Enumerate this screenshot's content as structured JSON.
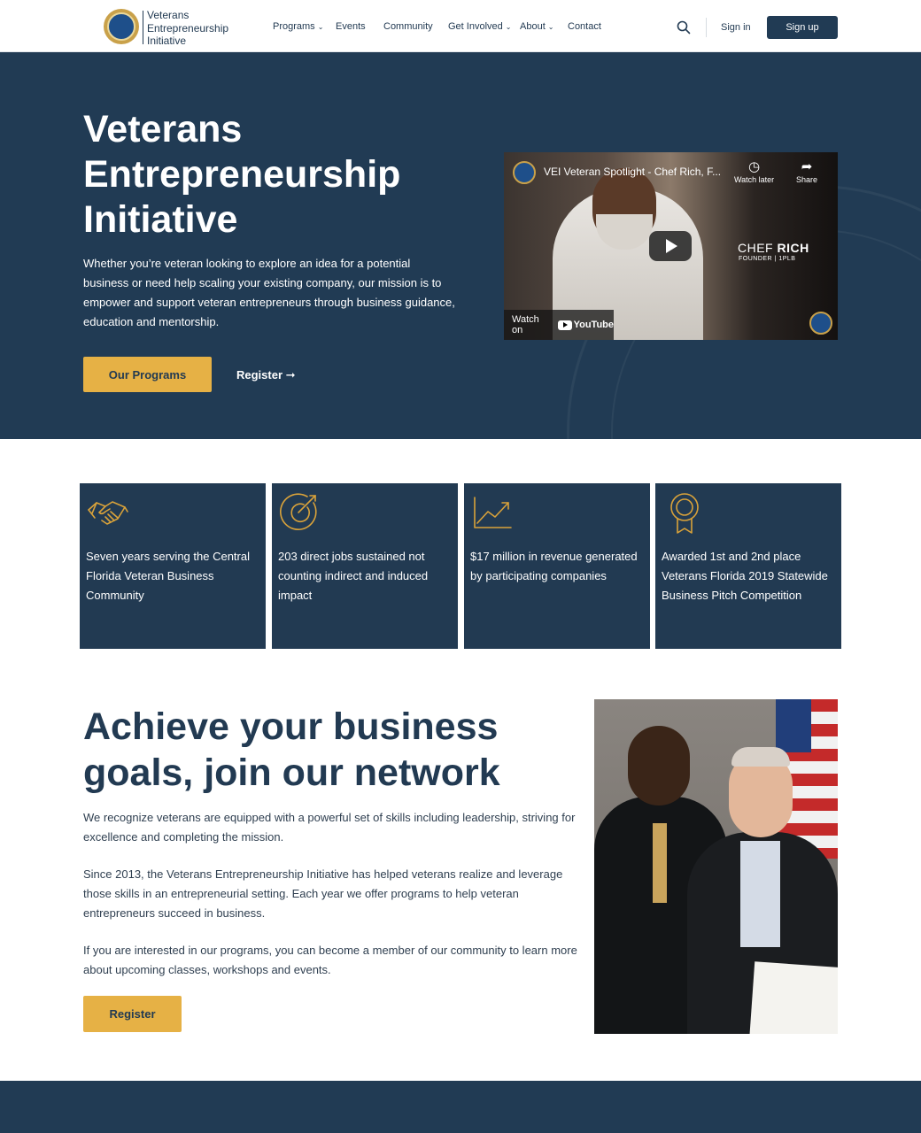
{
  "header": {
    "logo_lines": [
      "Veterans",
      "Entrepreneurship",
      "Initiative"
    ],
    "nav": [
      {
        "label": "Programs",
        "has_dropdown": true
      },
      {
        "label": "Events",
        "has_dropdown": false
      },
      {
        "label": "Community",
        "has_dropdown": false
      },
      {
        "label": "Get Involved",
        "has_dropdown": true
      },
      {
        "label": "About",
        "has_dropdown": true
      },
      {
        "label": "Contact",
        "has_dropdown": false
      }
    ],
    "sign_in": "Sign in",
    "sign_up": "Sign up",
    "search_icon": "search-icon"
  },
  "hero": {
    "title": "Veterans Entrepreneurship Initiative",
    "text": "Whether you’re veteran looking to explore an idea for a potential business or need help scaling your existing company, our mission is to empower and support veteran entrepreneurs through business guidance, education and mentorship.",
    "primary_button": "Our Programs",
    "secondary_link": "Register ➞",
    "video": {
      "title": "VEI Veteran Spotlight - Chef Rich, F...",
      "watch_later": "Watch later",
      "share": "Share",
      "name_label_1": "CHEF",
      "name_label_2": "RICH",
      "role_label": "FOUNDER | 1PLB",
      "watch_on": "Watch on",
      "youtube": "YouTube"
    }
  },
  "stats": [
    {
      "icon": "handshake-icon",
      "text": "Seven years serving the Central Florida Veteran Business Community"
    },
    {
      "icon": "target-icon",
      "text": "203 direct jobs sustained not counting indirect and induced impact"
    },
    {
      "icon": "growth-chart-icon",
      "text": "$17 million in revenue generated by participating companies"
    },
    {
      "icon": "award-ribbon-icon",
      "text": "Awarded 1st and 2nd place Veterans Florida 2019 Statewide Business Pitch Competition"
    }
  ],
  "achieve": {
    "title": "Achieve your business goals, join our network",
    "paragraphs": [
      "We recognize veterans are equipped with a powerful set of skills including leadership, striving for excellence and completing the mission.",
      "Since 2013, the Veterans Entrepreneurship Initiative has helped veterans realize and leverage those skills in an entrepreneurial setting. Each year we offer programs to help veteran entrepreneurs succeed in business.",
      "If you are interested in our programs, you can become a member of our community to learn more about upcoming classes, workshops and events."
    ],
    "button": "Register"
  },
  "colors": {
    "navy": "#213b54",
    "gold": "#e6b145",
    "icon_gold": "#d9a23a"
  }
}
